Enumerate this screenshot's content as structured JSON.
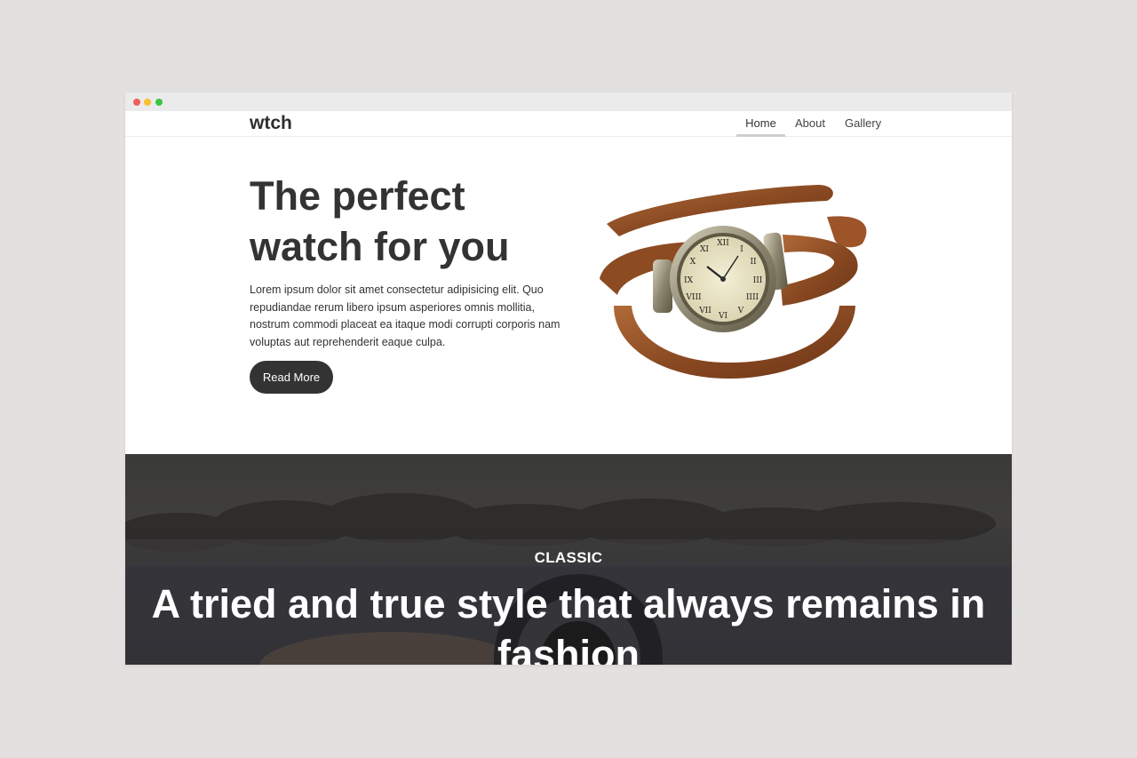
{
  "brand": {
    "logo": "wtch"
  },
  "nav": {
    "items": [
      {
        "label": "Home",
        "active": true
      },
      {
        "label": "About"
      },
      {
        "label": "Gallery"
      }
    ]
  },
  "hero": {
    "title": "The perfect watch for you",
    "body": "Lorem ipsum dolor sit amet consectetur adipisicing elit. Quo repudiandae rerum libero ipsum asperiores omnis mollitia, nostrum commodi placeat ea itaque modi corrupti corporis nam voluptas aut reprehenderit eaque culpa.",
    "cta": "Read More"
  },
  "banner": {
    "eyebrow": "CLASSIC",
    "tagline": "A tried and true style that always remains in fashion"
  },
  "colors": {
    "page_bg": "#e2e1df",
    "dark": "#333333",
    "text": "#333333",
    "nav_active_underline": "#cfcfcf"
  }
}
